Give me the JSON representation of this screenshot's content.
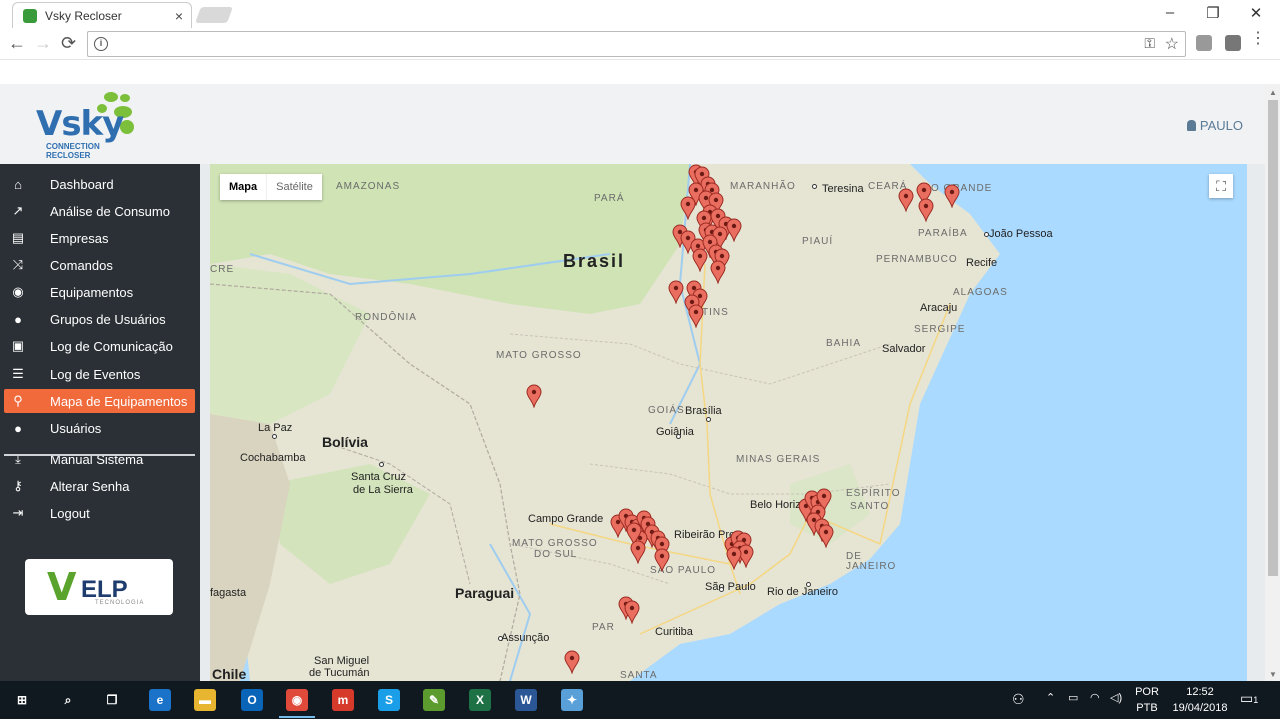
{
  "browser": {
    "tab_title": "Vsky Recloser",
    "tab_close": "×",
    "window_minimize": "–",
    "window_restore": "❐",
    "window_close": "✕",
    "back": "←",
    "forward": "→",
    "reload": "⟳",
    "menu": "⋮"
  },
  "app": {
    "logo_text": "Vsky",
    "logo_sub1": "CONNECTION",
    "logo_sub2": "RECLOSER",
    "user_name": "PAULO"
  },
  "sidebar": {
    "items": [
      {
        "label": "Dashboard",
        "icon": "home-icon",
        "glyph": "⌂"
      },
      {
        "label": "Análise de Consumo",
        "icon": "line-chart-icon",
        "glyph": "↗"
      },
      {
        "label": "Empresas",
        "icon": "id-card-icon",
        "glyph": "▤"
      },
      {
        "label": "Comandos",
        "icon": "shuffle-icon",
        "glyph": "⤨"
      },
      {
        "label": "Equipamentos",
        "icon": "podcast-icon",
        "glyph": "◉"
      },
      {
        "label": "Grupos de Usuários",
        "icon": "users-icon",
        "glyph": "●"
      },
      {
        "label": "Log de Comunicação",
        "icon": "file-code-icon",
        "glyph": "▣"
      },
      {
        "label": "Log de Eventos",
        "icon": "list-icon",
        "glyph": "☰"
      },
      {
        "label": "Mapa de Equipamentos",
        "icon": "map-marker-icon",
        "glyph": "⚲"
      },
      {
        "label": "Usuários",
        "icon": "user-icon",
        "glyph": "●"
      },
      {
        "label": "Manual Sistema",
        "icon": "download-icon",
        "glyph": "⤓"
      },
      {
        "label": "Alterar Senha",
        "icon": "key-icon",
        "glyph": "⚷"
      },
      {
        "label": "Logout",
        "icon": "sign-out-icon",
        "glyph": "⇥"
      }
    ],
    "active_index": 8,
    "velp_text": "ELP",
    "velp_v": "V",
    "velp_sub": "TECNOLOGIA"
  },
  "map": {
    "type_buttons": [
      "Mapa",
      "Satélite"
    ],
    "fullscreen": "⛶",
    "labels": [
      {
        "text": "AMAZONAS",
        "kind": "region"
      },
      {
        "text": "PARÁ",
        "kind": "region"
      },
      {
        "text": "MARANHÃO",
        "kind": "region"
      },
      {
        "text": "Teresina",
        "kind": "city"
      },
      {
        "text": "CEARÁ",
        "kind": "region"
      },
      {
        "text": "RIO GRANDE",
        "kind": "region"
      },
      {
        "text": "PARAÍBA",
        "kind": "region"
      },
      {
        "text": "João Pessoa",
        "kind": "city"
      },
      {
        "text": "PERNAMBUCO",
        "kind": "region"
      },
      {
        "text": "Recife",
        "kind": "city"
      },
      {
        "text": "PIAUÍ",
        "kind": "region"
      },
      {
        "text": "ALAGOAS",
        "kind": "region"
      },
      {
        "text": "Aracaju",
        "kind": "city"
      },
      {
        "text": "SERGIPE",
        "kind": "region"
      },
      {
        "text": "Brasil",
        "kind": "big"
      },
      {
        "text": "CRE",
        "kind": "region"
      },
      {
        "text": "RONDÔNIA",
        "kind": "region"
      },
      {
        "text": "TINS",
        "kind": "region"
      },
      {
        "text": "BAHIA",
        "kind": "region"
      },
      {
        "text": "Salvador",
        "kind": "city"
      },
      {
        "text": "MATO GROSSO",
        "kind": "region"
      },
      {
        "text": "GOIÁS",
        "kind": "region"
      },
      {
        "text": "Brasília",
        "kind": "city"
      },
      {
        "text": "Goiânia",
        "kind": "city"
      },
      {
        "text": "La Paz",
        "kind": "city"
      },
      {
        "text": "Bolívia",
        "kind": "country"
      },
      {
        "text": "Cochabamba",
        "kind": "city"
      },
      {
        "text": "MINAS GERAIS",
        "kind": "region"
      },
      {
        "text": "Santa Cruz",
        "kind": "city"
      },
      {
        "text": "de La Sierra",
        "kind": "city"
      },
      {
        "text": "Belo Horizonte",
        "kind": "city"
      },
      {
        "text": "ESPÍRITO",
        "kind": "region"
      },
      {
        "text": "SANTO",
        "kind": "region"
      },
      {
        "text": "Campo Grande",
        "kind": "city"
      },
      {
        "text": "Ribeirão Preto",
        "kind": "city"
      },
      {
        "text": "MATO GROSSO",
        "kind": "region"
      },
      {
        "text": "DO SUL",
        "kind": "region"
      },
      {
        "text": "SÃO PAULO",
        "kind": "region"
      },
      {
        "text": "DE",
        "kind": "region"
      },
      {
        "text": "JANEIRO",
        "kind": "region"
      },
      {
        "text": "fagasta",
        "kind": "city"
      },
      {
        "text": "Paraguai",
        "kind": "country"
      },
      {
        "text": "São Paulo",
        "kind": "city"
      },
      {
        "text": "Rio de Janeiro",
        "kind": "city"
      },
      {
        "text": "PAR",
        "kind": "region"
      },
      {
        "text": "Curitiba",
        "kind": "city"
      },
      {
        "text": "Assunção",
        "kind": "city"
      },
      {
        "text": "San Miguel",
        "kind": "city"
      },
      {
        "text": "de Tucumán",
        "kind": "city"
      },
      {
        "text": "Chile",
        "kind": "country"
      },
      {
        "text": "SANTA",
        "kind": "region"
      }
    ]
  },
  "taskbar": {
    "apps": [
      "windows-start",
      "search",
      "task-view",
      "edge",
      "explorer",
      "outlook",
      "chrome",
      "app-red",
      "skype",
      "notepad",
      "excel",
      "word",
      "paint"
    ],
    "lang1": "POR",
    "lang2": "PTB",
    "time": "12:52",
    "date": "19/04/2018",
    "notif": "1"
  }
}
